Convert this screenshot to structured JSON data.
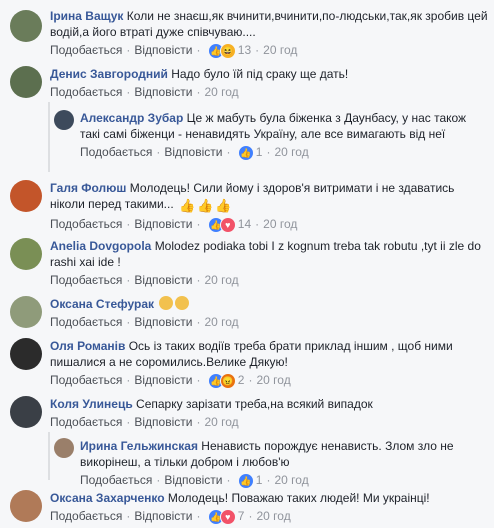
{
  "comments": [
    {
      "author": "Ірина Ващук",
      "text": "Коли не знаєш,як вчинити,вчинити,по-людськи,так,як зробив цей водій,а його втраті дуже співчуваю....",
      "like": "Подобається",
      "reply": "Відповісти",
      "reactions": [
        "like",
        "haha"
      ],
      "count": "13",
      "time": "20 год",
      "avatar_color": "#6a7c5a"
    },
    {
      "author": "Денис Завгородний",
      "text": "Надо було їй під сраку ще дать!",
      "like": "Подобається",
      "reply": "Відповісти",
      "reactions": [],
      "count": "",
      "time": "20 год",
      "avatar_color": "#5c6f4f"
    },
    {
      "author": "Александр Зубар",
      "text": "Це ж мабуть була біженка з Даунбасу, у нас також такі самі біженци - ненавидять Україну, але все вимагають від неї",
      "like": "Подобається",
      "reply": "Відповісти",
      "reactions": [
        "like"
      ],
      "count": "1",
      "time": "20 год",
      "avatar_color": "#3d4a5c"
    },
    {
      "author": "Галя Фолюш",
      "text": "Молодець! Сили йому і здоров'я витримати і не здаватись ніколи перед такими...",
      "like": "Подобається",
      "reply": "Відповісти",
      "reactions": [
        "like",
        "love"
      ],
      "count": "14",
      "time": "20 год",
      "avatar_color": "#c3552a"
    },
    {
      "author": "Anelia Dovgopola",
      "text": "Molodez podiaka tobi I z kognum treba tak robutu ,tyt ii zle do rashi xai ide !",
      "like": "Подобається",
      "reply": "Відповісти",
      "reactions": [],
      "count": "",
      "time": "20 год",
      "avatar_color": "#7a8f55"
    },
    {
      "author": "Оксана Стефурак",
      "text": "",
      "like": "Подобається",
      "reply": "Відповісти",
      "reactions": [],
      "count": "",
      "time": "20 год",
      "avatar_color": "#8f9b7a"
    },
    {
      "author": "Оля Романів",
      "text": "Ось із таких водіїв треба брати приклад іншим , щоб ними пишалися а не соромились.Велике Дякую!",
      "like": "Подобається",
      "reply": "Відповісти",
      "reactions": [
        "like",
        "angry"
      ],
      "count": "2",
      "time": "20 год",
      "avatar_color": "#2b2b2b"
    },
    {
      "author": "Коля Улинець",
      "text": "Сепарку зарізати треба,на всякий випадок",
      "like": "Подобається",
      "reply": "Відповісти",
      "reactions": [],
      "count": "",
      "time": "20 год",
      "avatar_color": "#3a3f46"
    },
    {
      "author": "Ирина Гельжинская",
      "text": "Ненависть порождує ненависть. Злом зло не викорінеш, а тільки добром і любов'ю",
      "like": "Подобається",
      "reply": "Відповісти",
      "reactions": [
        "like"
      ],
      "count": "1",
      "time": "20 год",
      "avatar_color": "#9a7f6a"
    },
    {
      "author": "Оксана Захарченко",
      "text": "Молодець! Поважаю таких людей! Ми украінці!",
      "like": "Подобається",
      "reply": "Відповісти",
      "reactions": [
        "like",
        "love"
      ],
      "count": "7",
      "time": "20 год",
      "avatar_color": "#b07a58"
    }
  ]
}
